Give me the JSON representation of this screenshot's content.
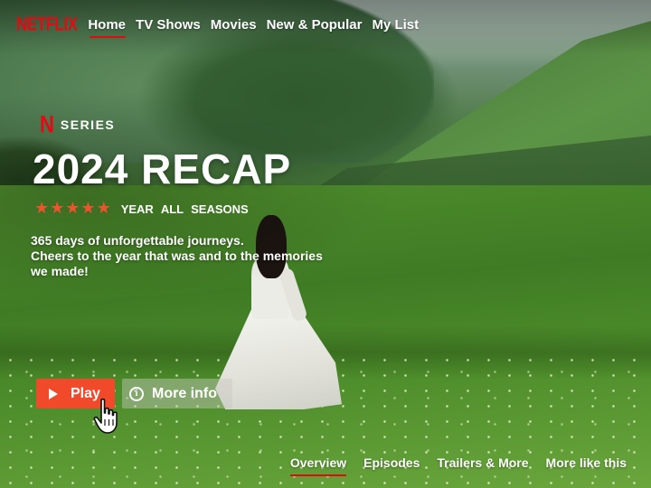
{
  "app": {
    "logo": "NETFLIX"
  },
  "nav": {
    "items": [
      {
        "label": "Home",
        "active": true
      },
      {
        "label": "TV Shows",
        "active": false
      },
      {
        "label": "Movies",
        "active": false
      },
      {
        "label": "New & Popular",
        "active": false
      },
      {
        "label": "My List",
        "active": false
      }
    ]
  },
  "hero": {
    "badge": "N",
    "type_label": "SERIES",
    "title": "2024 RECAP",
    "rating_stars": 5,
    "tags": [
      "YEAR",
      "ALL",
      "SEASONS"
    ],
    "description_lines": [
      "365 days of unforgettable journeys.",
      "Cheers to the year that was and to the memories",
      "we made!"
    ]
  },
  "buttons": {
    "play_label": "Play",
    "info_label": "More info",
    "info_glyph": "i"
  },
  "tabs": [
    {
      "label": "Overview",
      "active": true
    },
    {
      "label": "Episodes",
      "active": false
    },
    {
      "label": "Trailers & More",
      "active": false
    },
    {
      "label": "More like this",
      "active": false
    }
  ],
  "colors": {
    "brand": "#e50914",
    "play": "#f04a2a",
    "stars": "#f0522e"
  },
  "icons": {
    "play": "play-icon",
    "info": "info-icon",
    "star": "star-icon",
    "cursor": "hand-pointer-icon"
  }
}
